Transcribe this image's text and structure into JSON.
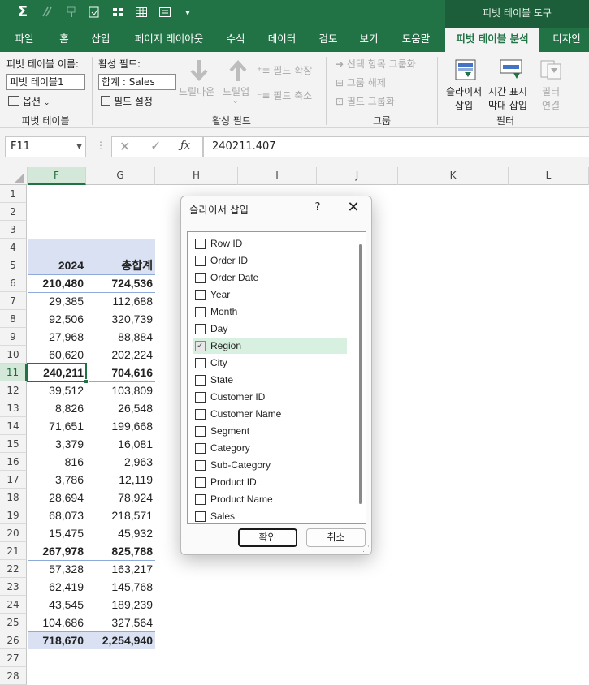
{
  "quick_access": {
    "icons": [
      "autosum-icon",
      "clear-format-icon",
      "format-painter-icon",
      "paste-values-icon",
      "grid-view-icon",
      "table-icon",
      "form-icon",
      "customize-qat-icon"
    ]
  },
  "contextual_tools": {
    "label": "피벗 테이블 도구"
  },
  "tabs": [
    {
      "label": "파일"
    },
    {
      "label": "홈"
    },
    {
      "label": "삽입"
    },
    {
      "label": "페이지 레이아웃"
    },
    {
      "label": "수식"
    },
    {
      "label": "데이터"
    },
    {
      "label": "검토"
    },
    {
      "label": "보기"
    },
    {
      "label": "도움말"
    },
    {
      "label": "피벗 테이블 분석"
    },
    {
      "label": "디자인"
    }
  ],
  "ribbon": {
    "pivot": {
      "name_label": "피벗 테이블 이름:",
      "name_value": "피벗 테이블1",
      "options_label": "옵션",
      "group_label": "피벗 테이블"
    },
    "active_field": {
      "label": "활성 필드:",
      "value": "합계 : Sales",
      "field_settings": "필드 설정",
      "drill_down": "드릴다운",
      "drill_up": "드릴업",
      "expand": "필드 확장",
      "collapse": "필드 축소",
      "group_label": "활성 필드"
    },
    "group": {
      "group_selection": "선택 항목 그룹화",
      "ungroup": "그룹 해제",
      "group_field": "필드 그룹화",
      "group_label": "그룹"
    },
    "filter": {
      "slicer_line1": "슬라이서",
      "slicer_line2": "삽입",
      "timeline_line1": "시간 표시",
      "timeline_line2": "막대 삽입",
      "filter_conn_line1": "필터",
      "filter_conn_line2": "연결",
      "group_label": "필터"
    }
  },
  "formula_bar": {
    "name_box": "F11",
    "formula": "240211.407"
  },
  "columns": [
    "F",
    "G",
    "H",
    "I",
    "J",
    "K",
    "L"
  ],
  "rows": [
    "1",
    "2",
    "3",
    "4",
    "5",
    "6",
    "7",
    "8",
    "9",
    "10",
    "11",
    "12",
    "13",
    "14",
    "15",
    "16",
    "17",
    "18",
    "19",
    "20",
    "21",
    "22",
    "23",
    "24",
    "25",
    "26",
    "27",
    "28"
  ],
  "pivot_header": {
    "col_f": "2024",
    "col_g": "총합계"
  },
  "pivot_values": [
    {
      "f": "210,480",
      "g": "724,536",
      "bold": true
    },
    {
      "f": "29,385",
      "g": "112,688",
      "bold": false
    },
    {
      "f": "92,506",
      "g": "320,739",
      "bold": false
    },
    {
      "f": "27,968",
      "g": "88,884",
      "bold": false
    },
    {
      "f": "60,620",
      "g": "202,224",
      "bold": false
    },
    {
      "f": "240,211",
      "g": "704,616",
      "bold": true
    },
    {
      "f": "39,512",
      "g": "103,809",
      "bold": false
    },
    {
      "f": "8,826",
      "g": "26,548",
      "bold": false
    },
    {
      "f": "71,651",
      "g": "199,668",
      "bold": false
    },
    {
      "f": "3,379",
      "g": "16,081",
      "bold": false
    },
    {
      "f": "816",
      "g": "2,963",
      "bold": false
    },
    {
      "f": "3,786",
      "g": "12,119",
      "bold": false
    },
    {
      "f": "28,694",
      "g": "78,924",
      "bold": false
    },
    {
      "f": "68,073",
      "g": "218,571",
      "bold": false
    },
    {
      "f": "15,475",
      "g": "45,932",
      "bold": false
    },
    {
      "f": "267,978",
      "g": "825,788",
      "bold": true
    },
    {
      "f": "57,328",
      "g": "163,217",
      "bold": false
    },
    {
      "f": "62,419",
      "g": "145,768",
      "bold": false
    },
    {
      "f": "43,545",
      "g": "189,239",
      "bold": false
    },
    {
      "f": "104,686",
      "g": "327,564",
      "bold": false
    },
    {
      "f": "718,670",
      "g": "2,254,940",
      "bold": true
    }
  ],
  "dialog": {
    "title": "슬라이서 삽입",
    "help": "?",
    "close": "✕",
    "fields": [
      {
        "label": "Row ID",
        "checked": false
      },
      {
        "label": "Order ID",
        "checked": false
      },
      {
        "label": "Order Date",
        "checked": false
      },
      {
        "label": "Year",
        "checked": false
      },
      {
        "label": "Month",
        "checked": false
      },
      {
        "label": "Day",
        "checked": false
      },
      {
        "label": "Region",
        "checked": true
      },
      {
        "label": "City",
        "checked": false
      },
      {
        "label": "State",
        "checked": false
      },
      {
        "label": "Customer ID",
        "checked": false
      },
      {
        "label": "Customer Name",
        "checked": false
      },
      {
        "label": "Segment",
        "checked": false
      },
      {
        "label": "Category",
        "checked": false
      },
      {
        "label": "Sub-Category",
        "checked": false
      },
      {
        "label": "Product ID",
        "checked": false
      },
      {
        "label": "Product Name",
        "checked": false
      },
      {
        "label": "Sales",
        "checked": false
      }
    ],
    "ok_label": "확인",
    "cancel_label": "취소"
  },
  "colors": {
    "excel_green": "#217346",
    "pivot_header_bg": "#d9e1f2",
    "selected_field_bg": "#d7f0df"
  }
}
